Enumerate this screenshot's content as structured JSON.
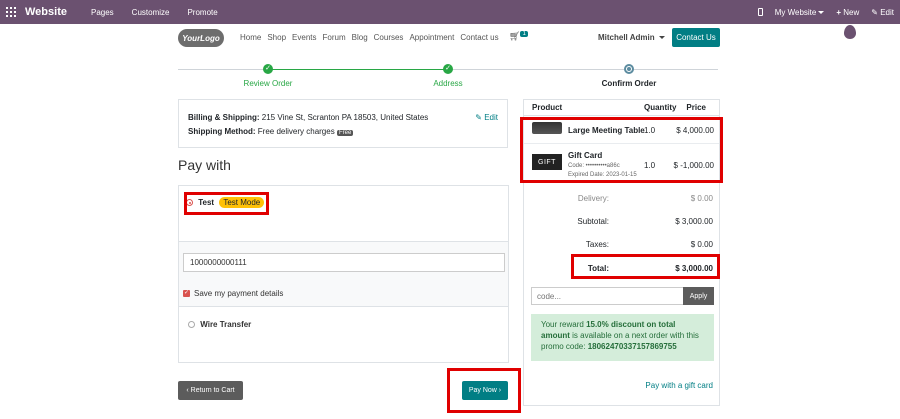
{
  "admin_bar": {
    "brand": "Website",
    "menu": [
      "Pages",
      "Customize",
      "Promote"
    ],
    "website_selector": "My Website",
    "new_label": "New",
    "edit_label": "Edit"
  },
  "header": {
    "logo_text": "YourLogo",
    "nav": [
      "Home",
      "Shop",
      "Events",
      "Forum",
      "Blog",
      "Courses",
      "Appointment",
      "Contact us"
    ],
    "cart_count": "1",
    "user_name": "Mitchell Admin",
    "contact_button": "Contact Us"
  },
  "wizard": {
    "steps": [
      "Review Order",
      "Address",
      "Confirm Order"
    ],
    "current_step_index": 2
  },
  "billing": {
    "billing_label": "Billing & Shipping:",
    "billing_value": "215 Vine St, Scranton PA 18503, United States",
    "shipping_label": "Shipping Method:",
    "shipping_value": "Free delivery charges",
    "free_badge": "Free",
    "edit_link": "Edit"
  },
  "payment": {
    "title": "Pay with",
    "test_option": "Test",
    "test_badge": "Test Mode",
    "card_number": "1000000000111",
    "save_details": "Save my payment details",
    "save_details_checked": true,
    "wire_option": "Wire Transfer",
    "back_button": "Return to Cart",
    "pay_button": "Pay Now"
  },
  "summary": {
    "headers": {
      "product": "Product",
      "quantity": "Quantity",
      "price": "Price"
    },
    "items": [
      {
        "name": "Large Meeting Table",
        "qty": "1.0",
        "price": "$ 4,000.00"
      },
      {
        "name": "Gift Card",
        "thumb_text": "GIFT",
        "code": "Code: ••••••••••a86c",
        "expiry": "Expired Date: 2023-01-15",
        "qty": "1.0",
        "price": "$ -1,000.00"
      }
    ],
    "delivery_label": "Delivery:",
    "delivery_value": "$ 0.00",
    "subtotal_label": "Subtotal:",
    "subtotal_value": "$ 3,000.00",
    "taxes_label": "Taxes:",
    "taxes_value": "$ 0.00",
    "total_label": "Total:",
    "total_value": "$ 3,000.00",
    "promo_placeholder": "code...",
    "apply_button": "Apply",
    "reward_pre": "Your reward ",
    "reward_bold": "15.0% discount on total amount",
    "reward_post": " is available on a next order with this promo code:",
    "reward_code": "18062470337157869755",
    "gift_card_link": "Pay with a gift card"
  },
  "colors": {
    "admin_bar": "#6b5170",
    "primary": "#017e84",
    "success": "#28a745",
    "highlight": "#e00000"
  }
}
